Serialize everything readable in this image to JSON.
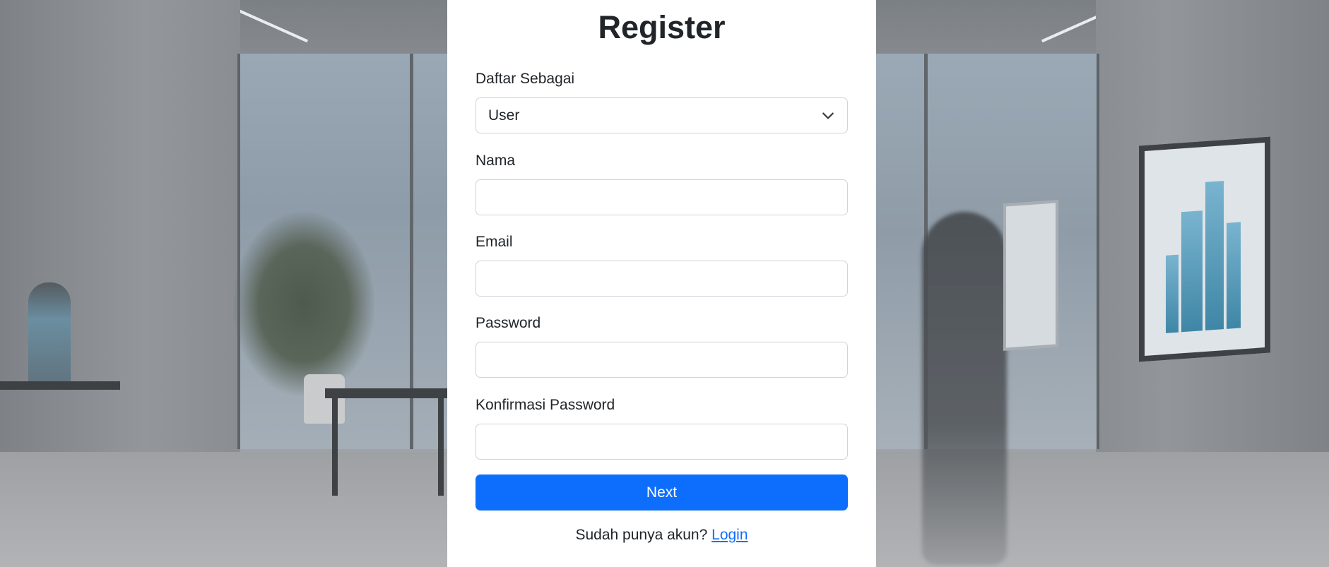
{
  "page": {
    "title": "Register",
    "accent_color": "#0d6efd"
  },
  "form": {
    "role": {
      "label": "Daftar Sebagai",
      "value": "User",
      "icon": "chevron-down-icon"
    },
    "name": {
      "label": "Nama",
      "value": "",
      "placeholder": ""
    },
    "email": {
      "label": "Email",
      "value": "",
      "placeholder": ""
    },
    "password": {
      "label": "Password",
      "value": "",
      "placeholder": ""
    },
    "confirm_password": {
      "label": "Konfirmasi Password",
      "value": "",
      "placeholder": ""
    },
    "submit_label": "Next"
  },
  "footer": {
    "prompt": "Sudah punya akun?",
    "login_link": "Login"
  }
}
